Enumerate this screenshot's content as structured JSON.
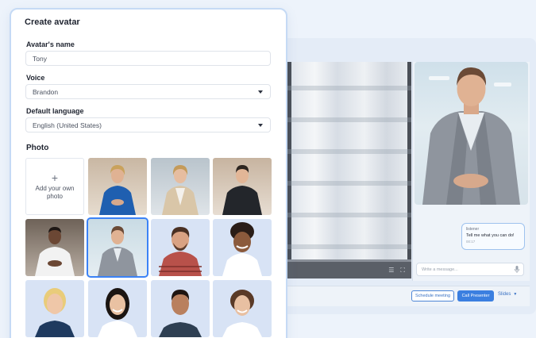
{
  "panel": {
    "title": "Create avatar",
    "name_label": "Avatar's name",
    "name_value": "Tony",
    "voice_label": "Voice",
    "voice_value": "Brandon",
    "language_label": "Default language",
    "language_value": "English (United States)",
    "photo_heading": "Photo",
    "add_photo_label": "Add your own photo"
  },
  "chat": {
    "sender": "listener",
    "message": "Tell me what you can do!",
    "time": "00:17",
    "input_placeholder": "Write a message..."
  },
  "actions": {
    "schedule_label": "Schedule meeting",
    "call_label": "Call Presenter",
    "slides_label": "Slides"
  },
  "colors": {
    "accent": "#3b7fe0",
    "selected_outline": "#3b82f6",
    "panel_border": "#c5daf5"
  }
}
